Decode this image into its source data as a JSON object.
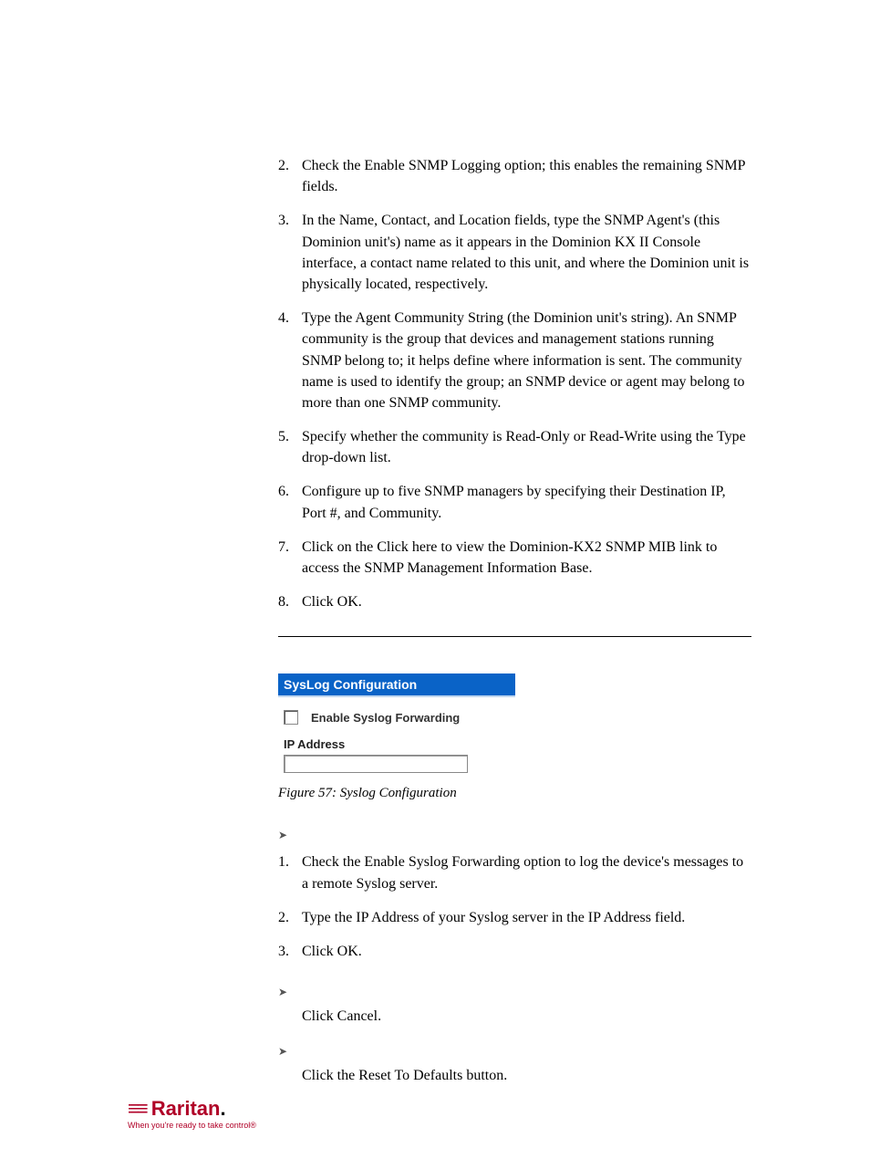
{
  "steps_top": [
    {
      "n": "2.",
      "t": "Check the Enable SNMP Logging option; this enables the remaining SNMP fields."
    },
    {
      "n": "3.",
      "t": "In the Name, Contact, and Location fields, type the SNMP Agent's (this Dominion unit's) name as it appears in the Dominion KX II Console interface, a contact name related to this unit, and where the Dominion unit is physically located, respectively."
    },
    {
      "n": "4.",
      "t": "Type the Agent Community String (the Dominion unit's string). An SNMP community is the group that devices and management stations running SNMP belong to; it helps define where information is sent. The community name is used to identify the group; an SNMP device or agent may belong to more than one SNMP community."
    },
    {
      "n": "5.",
      "t": "Specify whether the community is Read-Only or Read-Write using the Type drop-down list."
    },
    {
      "n": "6.",
      "t": "Configure up to five SNMP managers by specifying their Destination IP, Port #, and Community."
    },
    {
      "n": "7.",
      "t": "Click on the Click here to view the Dominion-KX2 SNMP MIB link to access the SNMP Management Information Base."
    },
    {
      "n": "8.",
      "t": "Click OK."
    }
  ],
  "panel": {
    "title": "SysLog Configuration",
    "checkbox_label": "Enable Syslog Forwarding",
    "ip_label": "IP Address"
  },
  "fig_caption": "Figure 57: Syslog Configuration",
  "steps_bottom": [
    {
      "n": "1.",
      "t": "Check the Enable Syslog Forwarding option to log the device's messages to a remote Syslog server."
    },
    {
      "n": "2.",
      "t": "Type the IP Address of your Syslog server in the IP Address field."
    },
    {
      "n": "3.",
      "t": "Click OK."
    }
  ],
  "cancel_text": "Click Cancel.",
  "reset_text": "Click the Reset To Defaults button.",
  "logo": {
    "brand": "Raritan",
    "dot": ".",
    "tagline": "When you're ready to take control®"
  }
}
